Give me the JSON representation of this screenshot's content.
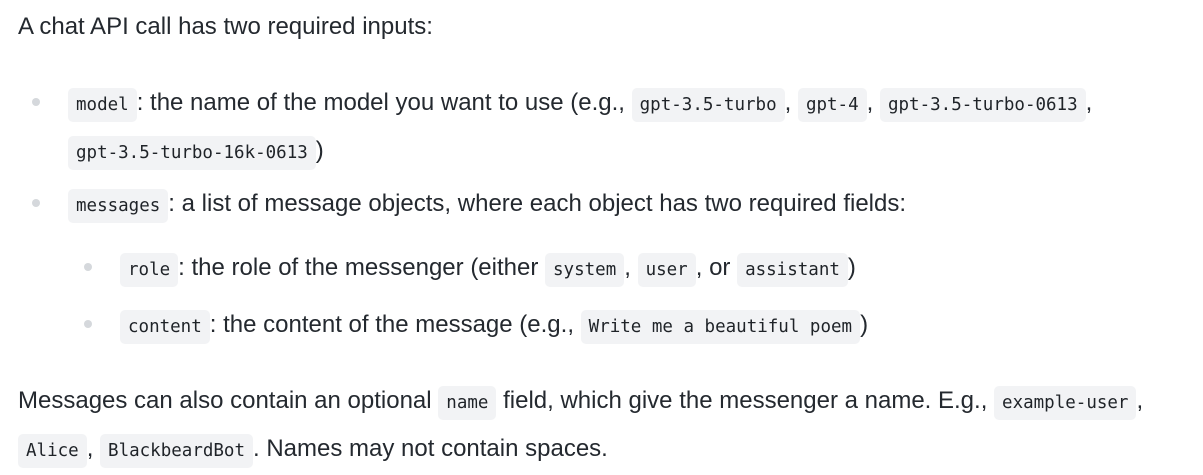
{
  "intro": "A chat API call has two required inputs:",
  "items": [
    {
      "code": "model",
      "text_before": ": the name of the model you want to use (e.g., ",
      "examples": [
        "gpt-3.5-turbo",
        "gpt-4",
        "gpt-3.5-turbo-0613",
        "gpt-3.5-turbo-16k-0613"
      ],
      "sep": ", ",
      "text_after": ")"
    },
    {
      "code": "messages",
      "text": ": a list of message objects, where each object has two required fields:",
      "subitems": [
        {
          "code": "role",
          "text_before": ": the role of the messenger (either ",
          "values": [
            "system",
            "user",
            "assistant"
          ],
          "sep": ", ",
          "or_word": ", or ",
          "text_after": ")"
        },
        {
          "code": "content",
          "text_before": ": the content of the message (e.g., ",
          "example": "Write me a beautiful poem",
          "text_after": ")"
        }
      ]
    }
  ],
  "outro": {
    "text1": "Messages can also contain an optional ",
    "code1": "name",
    "text2": " field, which give the messenger a name. E.g., ",
    "codes": [
      "example-user",
      "Alice",
      "BlackbeardBot"
    ],
    "sep": ", ",
    "text3": ". Names may not contain spaces."
  }
}
